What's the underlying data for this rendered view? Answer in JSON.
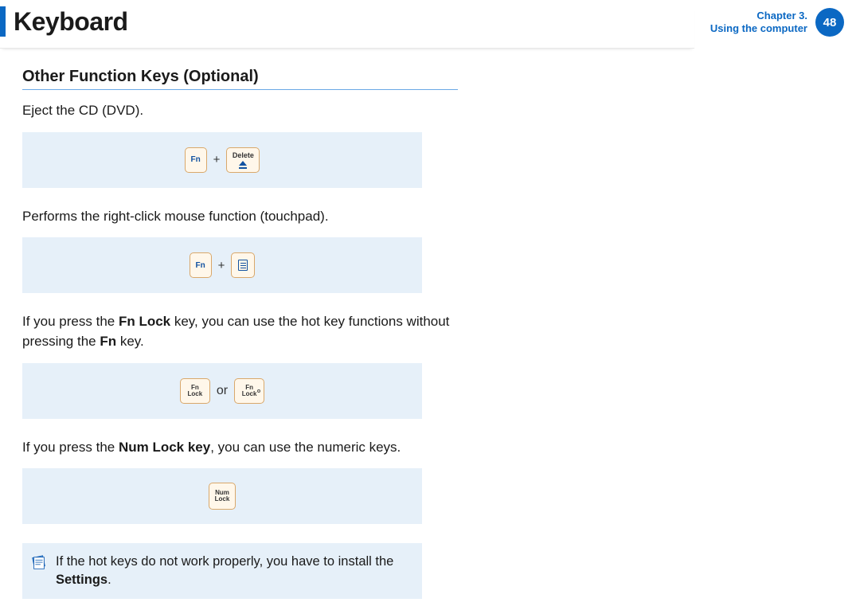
{
  "header": {
    "title": "Keyboard",
    "chapter_line1": "Chapter 3.",
    "chapter_line2": "Using the computer",
    "page_number": "48"
  },
  "section": {
    "heading": "Other Function Keys (Optional)",
    "items": [
      {
        "text_html": "Eject the CD (DVD).",
        "keys": {
          "fn": "Fn",
          "plus": "+",
          "del": "Delete"
        }
      },
      {
        "text_html": "Performs the right-click mouse function (touchpad).",
        "keys": {
          "fn": "Fn",
          "plus": "+"
        }
      },
      {
        "text_html": "If you press the <b>Fn Lock</b> key, you can use the hot key functions without pressing the <b>Fn</b> key.",
        "keys": {
          "fnlock1a": "Fn",
          "fnlock1b": "Lock",
          "or": "or",
          "fnlock2a": "Fn",
          "fnlock2b": "Lock"
        }
      },
      {
        "text_html": "If you press the <b>Num Lock key</b>, you can use the numeric keys.",
        "keys": {
          "numlock1": "Num",
          "numlock2": "Lock"
        }
      }
    ],
    "note_html": "If the hot keys do not work properly, you have to install the <b>Settings</b>."
  }
}
